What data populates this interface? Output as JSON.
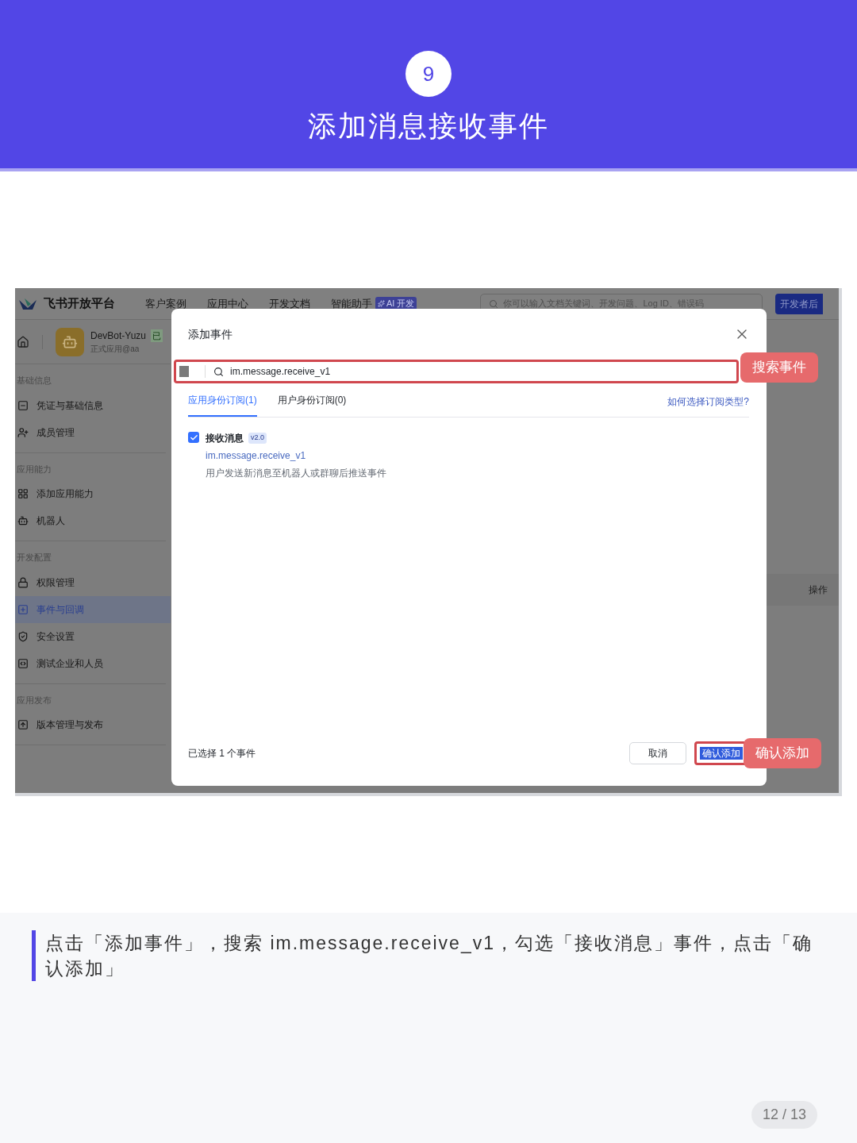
{
  "header": {
    "step": "9",
    "title": "添加消息接收事件"
  },
  "screenshot": {
    "nav": {
      "logo_text": "飞书开放平台",
      "links": [
        "客户案例",
        "应用中心",
        "开发文档",
        "智能助手"
      ],
      "ai_badge": "AI 开发",
      "search_placeholder": "你可以输入文档关键词、开发问题、Log ID、错误码",
      "dev_button": "开发者后"
    },
    "app": {
      "name": "DevBot-Yuzu",
      "status_badge": "已",
      "subtitle": "正式应用@aa"
    },
    "sidebar": [
      {
        "title": "基础信息",
        "items": [
          {
            "label": "凭证与基础信息",
            "selected": false
          },
          {
            "label": "成员管理",
            "selected": false
          }
        ]
      },
      {
        "title": "应用能力",
        "items": [
          {
            "label": "添加应用能力",
            "selected": false
          },
          {
            "label": "机器人",
            "selected": false
          }
        ]
      },
      {
        "title": "开发配置",
        "items": [
          {
            "label": "权限管理",
            "selected": false
          },
          {
            "label": "事件与回调",
            "selected": true
          },
          {
            "label": "安全设置",
            "selected": false
          },
          {
            "label": "测试企业和人员",
            "selected": false
          }
        ]
      },
      {
        "title": "应用发布",
        "items": [
          {
            "label": "版本管理与发布",
            "selected": false
          }
        ]
      }
    ],
    "table_header": "操作",
    "dialog": {
      "title": "添加事件",
      "search_value": "im.message.receive_v1",
      "tabs": [
        {
          "label": "应用身份订阅(1)",
          "selected": true
        },
        {
          "label": "用户身份订阅(0)",
          "selected": false
        }
      ],
      "help_link": "如何选择订阅类型?",
      "events": [
        {
          "name": "接收消息",
          "version": "v2.0",
          "code": "im.message.receive_v1",
          "description": "用户发送新消息至机器人或群聊后推送事件",
          "checked": true
        }
      ],
      "selected_count": "已选择 1 个事件",
      "cancel": "取消",
      "confirm": "确认添加"
    },
    "callouts": [
      {
        "text": "搜索事件"
      },
      {
        "text": "确认添加"
      }
    ]
  },
  "caption": "点击「添加事件」，搜索 im.message.receive_v1，勾选「接收消息」事件，点击「确认添加」",
  "page_indicator": "12 / 13"
}
